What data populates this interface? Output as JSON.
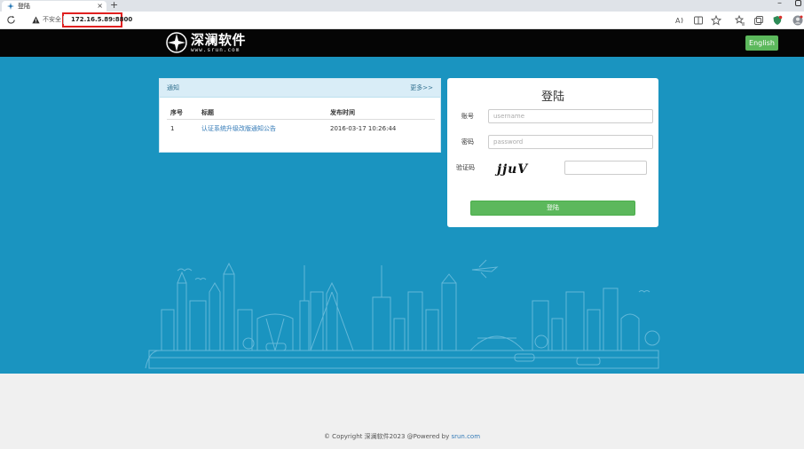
{
  "browser": {
    "tab_title": "登陆",
    "new_tab": "+",
    "close": "×",
    "insecure_label": "不安全",
    "url": "172.16.5.89:8800"
  },
  "header": {
    "logo_text": "深澜软件",
    "logo_sub": "www.srun.com",
    "lang_button": "English"
  },
  "notice": {
    "title": "通知",
    "more": "更多>>",
    "columns": [
      "序号",
      "标题",
      "发布时间"
    ],
    "rows": [
      {
        "index": "1",
        "title": "认证系统升级改版通知公告",
        "date": "2016-03-17 10:26:44"
      }
    ]
  },
  "login": {
    "title": "登陆",
    "account_label": "账号",
    "account_placeholder": "username",
    "password_label": "密码",
    "password_placeholder": "password",
    "captcha_label": "验证码",
    "captcha_text": "jjuV",
    "submit_label": "登陆"
  },
  "footer": {
    "text": "© Copyright 深澜软件2023 @Powered by ",
    "link": "srun.com"
  },
  "colors": {
    "hero_bg": "#1a94c0",
    "header_bg": "#050505",
    "accent_green": "#5cb85c",
    "url_highlight": "#e02020"
  }
}
